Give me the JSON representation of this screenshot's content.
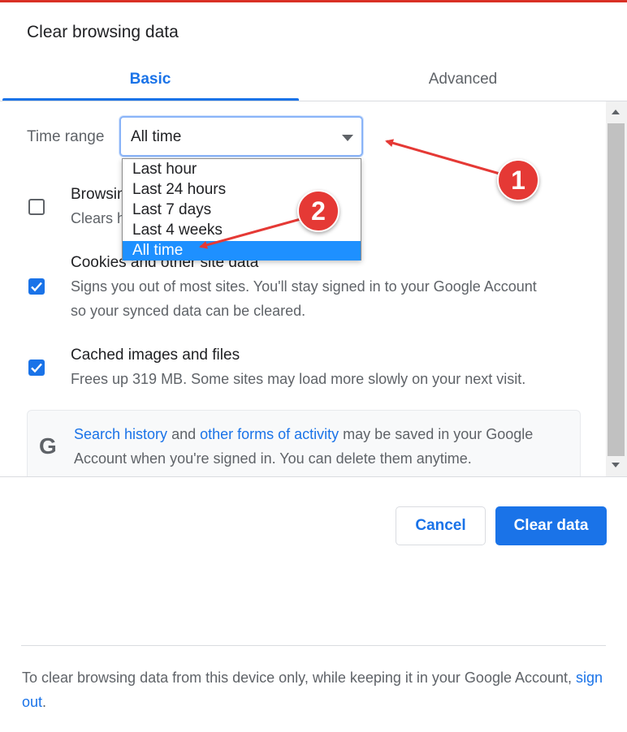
{
  "dialog": {
    "title": "Clear browsing data",
    "tabs": [
      {
        "label": "Basic",
        "active": true
      },
      {
        "label": "Advanced",
        "active": false
      }
    ]
  },
  "time_range": {
    "label": "Time range",
    "selected": "All time",
    "options": [
      "Last hour",
      "Last 24 hours",
      "Last 7 days",
      "Last 4 weeks",
      "All time"
    ]
  },
  "items": [
    {
      "title": "Browsin",
      "description": "Clears h",
      "checked": false
    },
    {
      "title": "Cookies and other site data",
      "description_line1": "Signs you out of most sites. You'll stay signed in to your Google Account",
      "description_line2": "so your synced data can be cleared.",
      "checked": true
    },
    {
      "title": "Cached images and files",
      "description": "Frees up 319 MB. Some sites may load more slowly on your next visit.",
      "checked": true
    }
  ],
  "info": {
    "icon": "google-g-icon",
    "link1": "Search history",
    "text1": " and ",
    "link2": "other forms of activity",
    "text2": " may be saved in your Google Account when you're signed in. You can delete them anytime."
  },
  "buttons": {
    "cancel": "Cancel",
    "clear": "Clear data"
  },
  "footer": {
    "text1": "To clear browsing data from this device only, while keeping it in your Google Account, ",
    "link": "sign out",
    "text2": "."
  },
  "annotations": {
    "badge1": "1",
    "badge2": "2"
  },
  "colors": {
    "accent": "#1a73e8",
    "annotation": "#e53935",
    "selected_option": "#1e90ff"
  }
}
